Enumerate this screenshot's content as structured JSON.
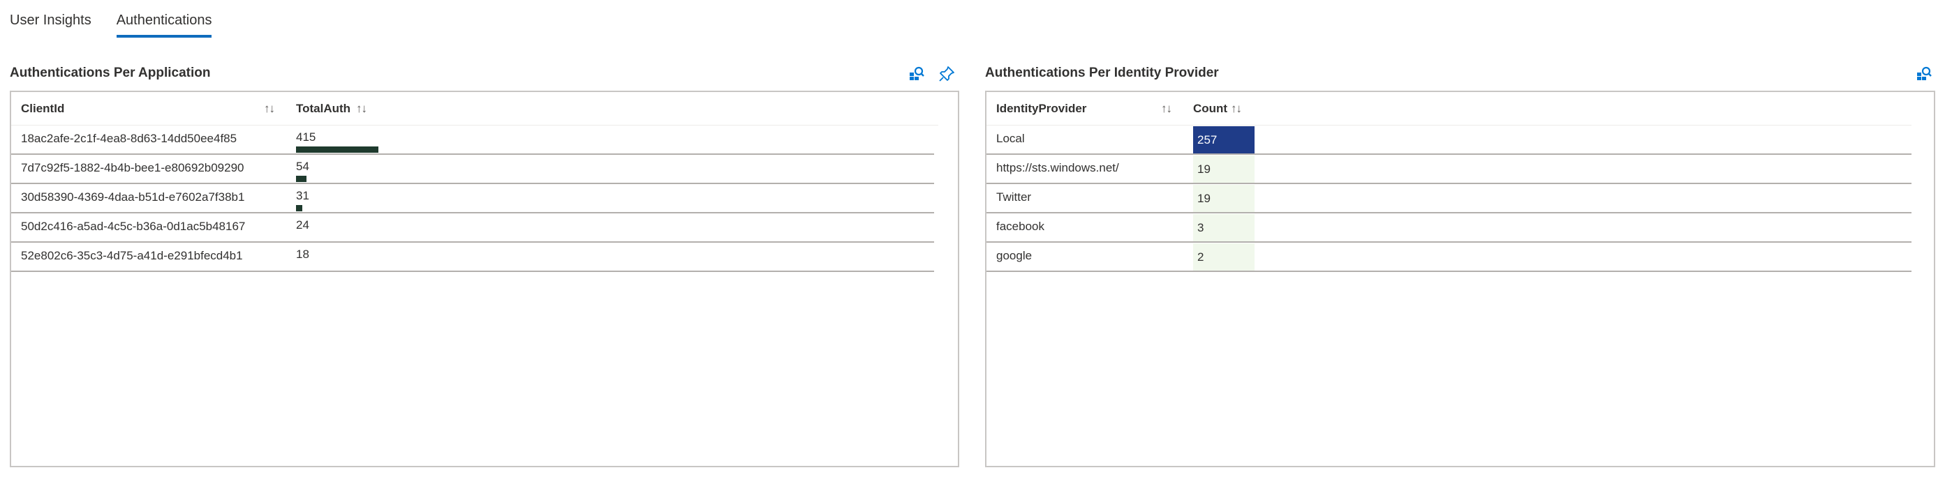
{
  "tabs": [
    {
      "label": "User Insights",
      "active": false
    },
    {
      "label": "Authentications",
      "active": true
    }
  ],
  "colors": {
    "accent": "#0f6cbd",
    "bar": "#1e3a2d",
    "heat_high": "#1f3c88",
    "heat_low": "#f1f8ec"
  },
  "left_panel": {
    "title": "Authentications Per Application",
    "icons": [
      "query-icon",
      "pin-icon"
    ],
    "columns": [
      "ClientId",
      "TotalAuth"
    ],
    "max_value": 415,
    "rows": [
      {
        "client_id": "18ac2afe-2c1f-4ea8-8d63-14dd50ee4f85",
        "total_auth": 415
      },
      {
        "client_id": "7d7c92f5-1882-4b4b-bee1-e80692b09290",
        "total_auth": 54
      },
      {
        "client_id": "30d58390-4369-4daa-b51d-e7602a7f38b1",
        "total_auth": 31
      },
      {
        "client_id": "50d2c416-a5ad-4c5c-b36a-0d1ac5b48167",
        "total_auth": 24
      },
      {
        "client_id": "52e802c6-35c3-4d75-a41d-e291bfecd4b1",
        "total_auth": 18
      }
    ]
  },
  "right_panel": {
    "title": "Authentications Per Identity Provider",
    "icons": [
      "query-icon"
    ],
    "columns": [
      "IdentityProvider",
      "Count"
    ],
    "max_value": 257,
    "rows": [
      {
        "provider": "Local",
        "count": 257
      },
      {
        "provider": "https://sts.windows.net/",
        "count": 19
      },
      {
        "provider": "Twitter",
        "count": 19
      },
      {
        "provider": "facebook",
        "count": 3
      },
      {
        "provider": "google",
        "count": 2
      }
    ]
  }
}
